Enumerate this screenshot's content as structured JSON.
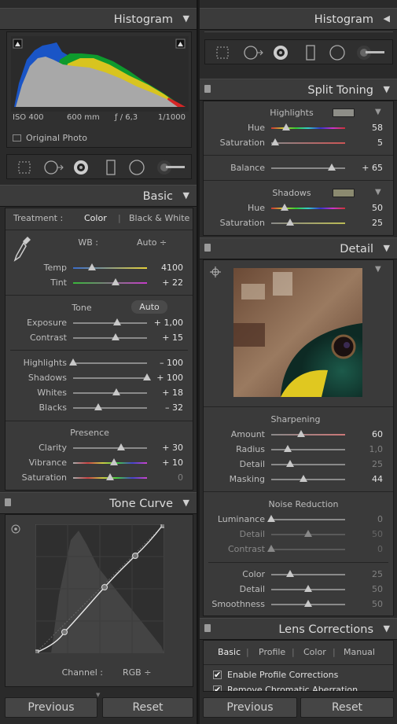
{
  "left": {
    "histogram": {
      "title": "Histogram",
      "info": {
        "iso": "ISO 400",
        "focal": "600 mm",
        "aperture": "ƒ / 6,3",
        "shutter": "1/1000"
      },
      "original_photo": "Original Photo"
    },
    "tools": [
      "crop-overlay-icon",
      "spot-removal-icon",
      "red-eye-icon",
      "graduated-filter-icon",
      "radial-filter-icon",
      "adjustment-brush-icon"
    ],
    "basic": {
      "title": "Basic",
      "treatment_label": "Treatment :",
      "treatment_color": "Color",
      "treatment_bw": "Black & White",
      "wb_label": "WB :",
      "wb_value": "Auto ÷",
      "temp": {
        "label": "Temp",
        "value": "4100",
        "pos": 0.25
      },
      "tint": {
        "label": "Tint",
        "value": "+ 22",
        "pos": 0.57
      },
      "tone_label": "Tone",
      "auto_label": "Auto",
      "exposure": {
        "label": "Exposure",
        "value": "+ 1,00",
        "pos": 0.6
      },
      "contrast": {
        "label": "Contrast",
        "value": "+ 15",
        "pos": 0.57
      },
      "highlights": {
        "label": "Highlights",
        "value": "– 100",
        "pos": 0.0
      },
      "shadows": {
        "label": "Shadows",
        "value": "+ 100",
        "pos": 1.0
      },
      "whites": {
        "label": "Whites",
        "value": "+ 18",
        "pos": 0.59
      },
      "blacks": {
        "label": "Blacks",
        "value": "– 32",
        "pos": 0.34
      },
      "presence_label": "Presence",
      "clarity": {
        "label": "Clarity",
        "value": "+ 30",
        "pos": 0.65
      },
      "vibrance": {
        "label": "Vibrance",
        "value": "+ 10",
        "pos": 0.55
      },
      "saturation": {
        "label": "Saturation",
        "value": "0",
        "pos": 0.5
      }
    },
    "tone_curve": {
      "title": "Tone Curve",
      "channel_label": "Channel :",
      "channel_value": "RGB ÷"
    },
    "previous": "Previous",
    "reset": "Reset"
  },
  "right": {
    "histogram": {
      "title": "Histogram"
    },
    "split_toning": {
      "title": "Split Toning",
      "highlights_label": "Highlights",
      "highlights_swatch": "#8e8e88",
      "hl_hue": {
        "label": "Hue",
        "value": "58",
        "pos": 0.2
      },
      "hl_sat": {
        "label": "Saturation",
        "value": "5",
        "pos": 0.05
      },
      "balance": {
        "label": "Balance",
        "value": "+ 65",
        "pos": 0.82
      },
      "shadows_label": "Shadows",
      "shadows_swatch": "#8b8a70",
      "sh_hue": {
        "label": "Hue",
        "value": "50",
        "pos": 0.18
      },
      "sh_sat": {
        "label": "Saturation",
        "value": "25",
        "pos": 0.25
      }
    },
    "detail": {
      "title": "Detail",
      "sharpening_label": "Sharpening",
      "amount": {
        "label": "Amount",
        "value": "60",
        "pos": 0.4
      },
      "radius": {
        "label": "Radius",
        "value": "1,0",
        "pos": 0.22
      },
      "s_detail": {
        "label": "Detail",
        "value": "25",
        "pos": 0.25
      },
      "masking": {
        "label": "Masking",
        "value": "44",
        "pos": 0.44
      },
      "noise_label": "Noise Reduction",
      "luminance": {
        "label": "Luminance",
        "value": "0",
        "pos": 0.0
      },
      "n_detail": {
        "label": "Detail",
        "value": "50",
        "pos": 0.5
      },
      "n_contrast": {
        "label": "Contrast",
        "value": "0",
        "pos": 0.0
      },
      "color": {
        "label": "Color",
        "value": "25",
        "pos": 0.25
      },
      "c_detail": {
        "label": "Detail",
        "value": "50",
        "pos": 0.5
      },
      "smoothness": {
        "label": "Smoothness",
        "value": "50",
        "pos": 0.5
      }
    },
    "lens": {
      "title": "Lens Corrections",
      "tabs": [
        "Basic",
        "Profile",
        "Color",
        "Manual"
      ],
      "enable_profile": "Enable Profile Corrections",
      "remove_ca": "Remove Chromatic Aberration"
    },
    "previous": "Previous",
    "reset": "Reset"
  }
}
